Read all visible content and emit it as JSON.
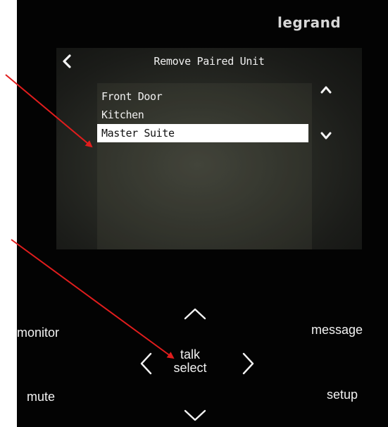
{
  "device": {
    "brand": "legrand"
  },
  "screen": {
    "title": "Remove Paired Unit",
    "items": [
      {
        "label": "Front Door",
        "selected": false
      },
      {
        "label": "Kitchen",
        "selected": false
      },
      {
        "label": "Master Suite",
        "selected": true
      }
    ]
  },
  "buttons": {
    "monitor": "monitor",
    "message": "message",
    "mute": "mute",
    "setup": "setup",
    "talk": "talk",
    "select": "select"
  },
  "icons": {
    "back": "chevron-left-icon",
    "scroll_up": "chevron-up-icon",
    "scroll_down": "chevron-down-icon",
    "nav_up": "chevron-up-icon",
    "nav_down": "chevron-down-icon",
    "nav_left": "chevron-left-icon",
    "nav_right": "chevron-right-icon"
  },
  "colors": {
    "panel_bg": "#030303",
    "screen_text": "#f0f0f0",
    "selection_bg": "#ffffff",
    "annotation_arrow": "#e11d1d"
  }
}
